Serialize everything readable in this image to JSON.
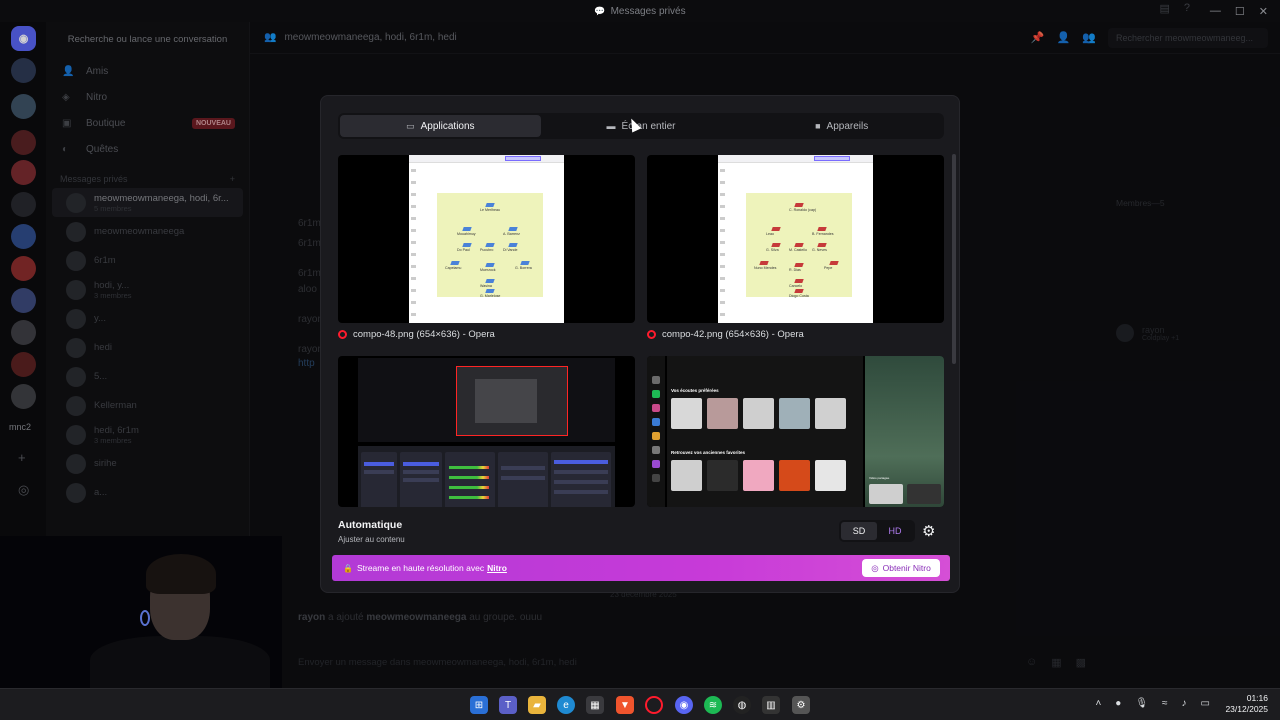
{
  "window": {
    "title": "Messages privés"
  },
  "sidebar": {
    "search_placeholder": "Recherche ou lance une conversation",
    "nav": [
      {
        "label": "Amis",
        "icon": "friends-icon"
      },
      {
        "label": "Nitro",
        "icon": "nitro-icon"
      },
      {
        "label": "Boutique",
        "icon": "shop-icon",
        "badge": "NOUVEAU"
      },
      {
        "label": "Quêtes",
        "icon": "quests-icon"
      }
    ],
    "dm_header": "Messages privés",
    "dms": [
      {
        "name": "meowmeowmaneega, hodi, 6r...",
        "sub": "5 membres",
        "active": true
      },
      {
        "name": "meowmeowmaneega",
        "sub": ""
      },
      {
        "name": "6r1m",
        "sub": ""
      },
      {
        "name": "hodi, y...",
        "sub": "3 membres"
      },
      {
        "name": "y...",
        "sub": ""
      },
      {
        "name": "hedi",
        "sub": ""
      },
      {
        "name": "5...",
        "sub": ""
      },
      {
        "name": "Kellerman",
        "sub": ""
      },
      {
        "name": "hedi, 6r1m",
        "sub": "3 membres"
      },
      {
        "name": "sirihe",
        "sub": ""
      },
      {
        "name": "a...",
        "sub": ""
      }
    ]
  },
  "rail": {
    "label": "mnc2"
  },
  "chat": {
    "header": "meowmeowmaneega, hodi, 6r1m, hedi",
    "search_placeholder": "Rechercher meowmeowmaneeg...",
    "members_title": "Membres—5",
    "members": [
      {
        "name": "rayon",
        "sub": "Coldplay +1"
      }
    ],
    "messages": [
      {
        "author": "6r1m",
        "text": ""
      },
      {
        "author": "6r1m",
        "text": ""
      },
      {
        "author": "6r1m",
        "text": "aloo"
      },
      {
        "author": "rayon",
        "text": ""
      },
      {
        "author": "rayon",
        "text": "http"
      }
    ],
    "date_separator": "23 décembre 2025",
    "system_message": {
      "author": "rayon",
      "action": "a ajouté",
      "target": "meowmeowmaneega",
      "tail": "au groupe. ouuu"
    },
    "composer_placeholder": "Envoyer un message dans meowmeowmaneega, hodi, 6r1m, hedi"
  },
  "modal": {
    "tabs": [
      {
        "label": "Applications",
        "icon": "window-icon",
        "active": true
      },
      {
        "label": "Écran entier",
        "icon": "monitor-icon",
        "active": false
      },
      {
        "label": "Appareils",
        "icon": "camera-icon",
        "active": false
      }
    ],
    "sources": [
      {
        "caption": "compo-48.png (654×636) - Opera",
        "kind": "lineup",
        "team_color": "#4a82d8",
        "players": [
          "Le Merlheau",
          "Mouahimuy",
          "A. Barrenz",
          "Do Paul",
          "Pucubro",
          "Di Vande",
          "Capelamu",
          "Muerzock",
          "G. Borrera",
          "Wasina",
          "G. Marlelose"
        ]
      },
      {
        "caption": "compo-42.png (654×636) - Opera",
        "kind": "lineup",
        "team_color": "#c63a3a",
        "players": [
          "C. Ronaldo (cap)",
          "Leao",
          "B. Fernandes",
          "G. Silva",
          "M. Castello",
          "G. Neves",
          "Nuno Mendes",
          "R. Dias",
          "Pepe",
          "Cancelo",
          "Diogo Costa"
        ]
      },
      {
        "caption": "",
        "kind": "obs"
      },
      {
        "caption": "",
        "kind": "spotify",
        "sections": [
          "Vos écoutes préférées",
          "Retrouvez vos anciennes favorites"
        ],
        "right_title": "Vidéo partagée"
      }
    ],
    "quality_title": "Automatique",
    "quality_sub": "Ajuster au contenu",
    "res_sd": "SD",
    "res_hd": "HD",
    "nitro_text": "Streame en haute résolution avec",
    "nitro_word": "Nitro",
    "nitro_button": "Obtenir Nitro"
  },
  "taskbar": {
    "time": "01:16",
    "date": "23/12/2025",
    "apps": [
      "start-icon",
      "teams-icon",
      "files-icon",
      "edge-icon",
      "store-icon",
      "brave-icon",
      "opera-icon",
      "discord-icon",
      "spotify-icon",
      "steam-icon",
      "code-icon",
      "settings-icon"
    ]
  },
  "colors": {
    "accent": "#5865f2",
    "nitro_gradient_start": "#b23ad6",
    "nitro_gradient_end": "#d54fd6",
    "hd": "#b07cf0"
  }
}
